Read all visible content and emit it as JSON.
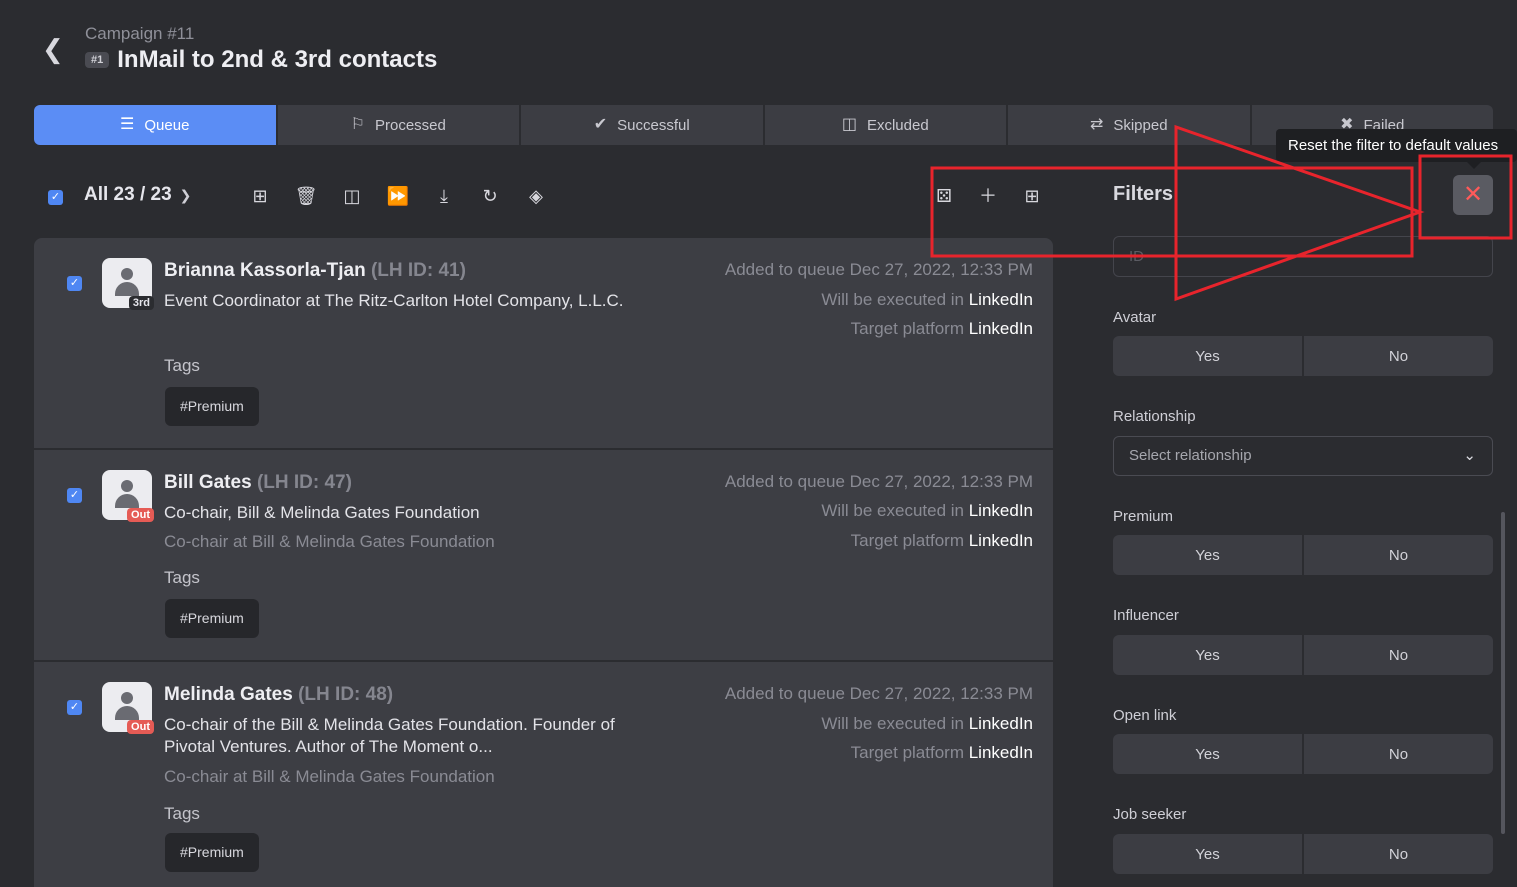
{
  "header": {
    "campaign_sub": "Campaign #11",
    "badge": "#1",
    "title": "InMail to 2nd & 3rd contacts"
  },
  "tabs": [
    {
      "label": "Queue",
      "icon": "queue-icon",
      "active": true
    },
    {
      "label": "Processed",
      "icon": "flag-icon",
      "active": false
    },
    {
      "label": "Successful",
      "icon": "check-icon",
      "active": false
    },
    {
      "label": "Excluded",
      "icon": "exclude-icon",
      "active": false
    },
    {
      "label": "Skipped",
      "icon": "skip-icon",
      "active": false
    },
    {
      "label": "Failed",
      "icon": "x-icon",
      "active": false
    }
  ],
  "toolbar": {
    "all_label": "All 23 / 23"
  },
  "rows": [
    {
      "name": "Brianna Kassorla-Tjan",
      "lhid": "(LH ID: 41)",
      "degree": "3rd",
      "headline": "Event Coordinator at The Ritz-Carlton Hotel Company, L.L.C.",
      "company": "",
      "tags_label": "Tags",
      "tag": "#Premium",
      "added": "Added to queue Dec 27, 2022, 12:33 PM",
      "exec_prefix": "Will be executed in ",
      "exec_value": "LinkedIn",
      "target_prefix": "Target platform ",
      "target_value": "LinkedIn"
    },
    {
      "name": "Bill Gates",
      "lhid": "(LH ID: 47)",
      "degree": "Out",
      "headline": "Co-chair, Bill & Melinda Gates Foundation",
      "company": "Co-chair at Bill & Melinda Gates Foundation",
      "tags_label": "Tags",
      "tag": "#Premium",
      "added": "Added to queue Dec 27, 2022, 12:33 PM",
      "exec_prefix": "Will be executed in ",
      "exec_value": "LinkedIn",
      "target_prefix": "Target platform ",
      "target_value": "LinkedIn"
    },
    {
      "name": "Melinda Gates",
      "lhid": "(LH ID: 48)",
      "degree": "Out",
      "headline": "Co-chair of the Bill & Melinda Gates Foundation. Founder of Pivotal Ventures. Author of The Moment o...",
      "company": "Co-chair at Bill & Melinda Gates Foundation",
      "tags_label": "Tags",
      "tag": "#Premium",
      "added": "Added to queue Dec 27, 2022, 12:33 PM",
      "exec_prefix": "Will be executed in ",
      "exec_value": "LinkedIn",
      "target_prefix": "Target platform ",
      "target_value": "LinkedIn"
    }
  ],
  "filters": {
    "title": "Filters",
    "tooltip": "Reset the filter to default values",
    "id_placeholder": "ID",
    "avatar": {
      "label": "Avatar",
      "yes": "Yes",
      "no": "No"
    },
    "relationship": {
      "label": "Relationship",
      "placeholder": "Select relationship"
    },
    "premium": {
      "label": "Premium",
      "yes": "Yes",
      "no": "No"
    },
    "influencer": {
      "label": "Influencer",
      "yes": "Yes",
      "no": "No"
    },
    "open_link": {
      "label": "Open link",
      "yes": "Yes",
      "no": "No"
    },
    "job_seeker": {
      "label": "Job seeker",
      "yes": "Yes",
      "no": "No"
    }
  },
  "colors": {
    "accent": "#5b8df5",
    "annotation": "#e8242c",
    "reset_x": "#ff5a5a"
  }
}
